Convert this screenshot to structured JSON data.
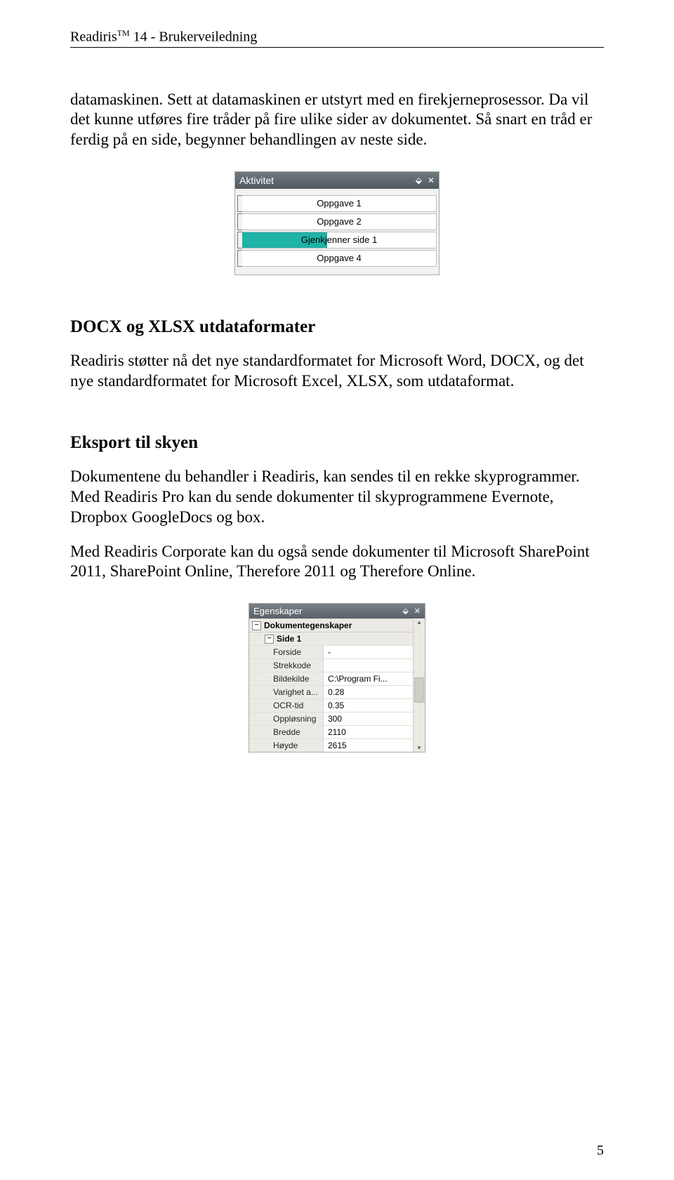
{
  "header": {
    "product": "Readiris",
    "tm": "TM",
    "version_suffix": " 14 - Brukerveiledning"
  },
  "paragraph1": "datamaskinen. Sett at datamaskinen er utstyrt med en firekjerneprosessor. Da vil det kunne utføres fire tråder på fire ulike sider av dokumentet. Så snart en tråd er ferdig på en side, begynner behandlingen av neste side.",
  "aktivitet_panel": {
    "title": "Aktivitet",
    "pin_glyph": "⬙",
    "close_glyph": "✕",
    "tasks": [
      {
        "label": "Oppgave 1",
        "fill_pct": 0
      },
      {
        "label": "Oppgave 2",
        "fill_pct": 0
      },
      {
        "label": "Gjenkjenner side 1",
        "fill_pct": 44
      },
      {
        "label": "Oppgave 4",
        "fill_pct": 0
      }
    ]
  },
  "section2_title": "DOCX og XLSX utdataformater",
  "paragraph2": "Readiris støtter nå det nye standardformatet for Microsoft Word, DOCX, og det nye standardformatet for Microsoft Excel, XLSX, som utdataformat.",
  "section3_title": "Eksport til skyen",
  "paragraph3": "Dokumentene du behandler i Readiris, kan sendes til en rekke skyprogrammer. Med Readiris Pro kan du sende dokumenter til skyprogrammene Evernote, Dropbox GoogleDocs og box.",
  "paragraph4": "Med Readiris Corporate kan du også sende dokumenter til Microsoft SharePoint 2011, SharePoint Online, Therefore 2011 og Therefore Online.",
  "props_panel": {
    "title": "Egenskaper",
    "pin_glyph": "⬙",
    "close_glyph": "✕",
    "group1": "Dokumentegenskaper",
    "group2": "Side 1",
    "rows": [
      {
        "k": "Forside",
        "v": "-"
      },
      {
        "k": "Strekkode",
        "v": ""
      },
      {
        "k": "Bildekilde",
        "v": "C:\\Program Fi..."
      },
      {
        "k": "Varighet a...",
        "v": "0.28"
      },
      {
        "k": "OCR-tid",
        "v": "0.35"
      },
      {
        "k": "Oppløsning",
        "v": "300"
      },
      {
        "k": "Bredde",
        "v": "2110"
      },
      {
        "k": "Høyde",
        "v": "2615"
      }
    ],
    "up_glyph": "▴",
    "down_glyph": "▾"
  },
  "page_number": "5"
}
